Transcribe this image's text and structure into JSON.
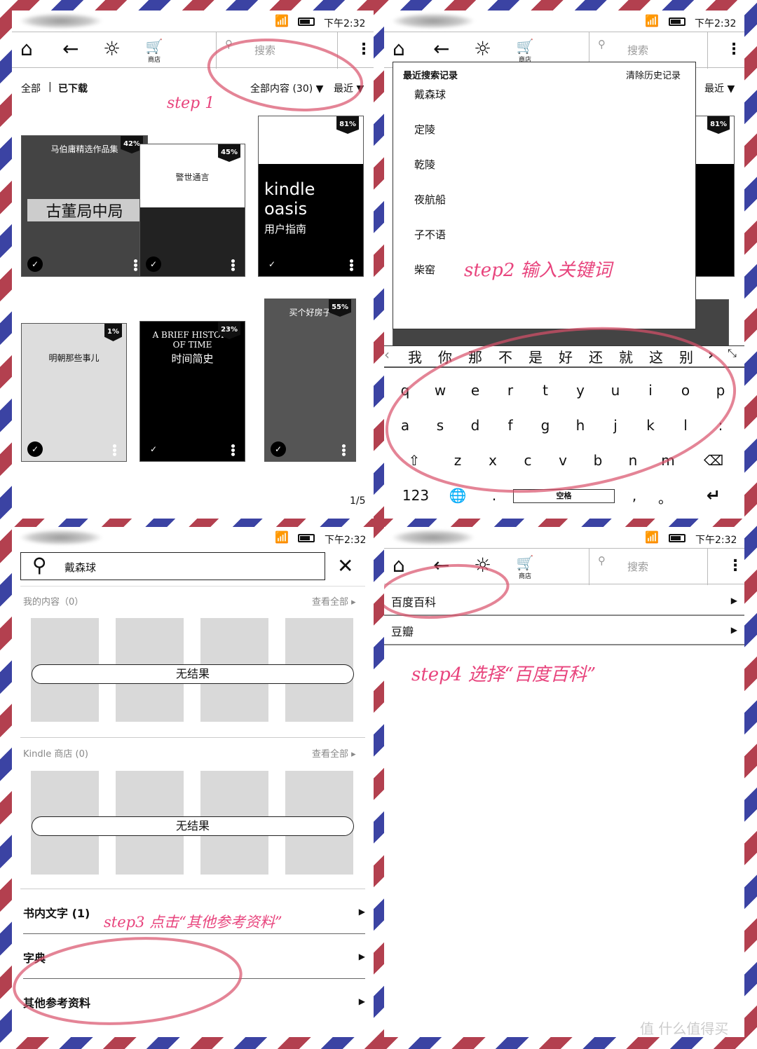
{
  "status": {
    "time": "下午2:32"
  },
  "toolbar": {
    "store_label": "商店",
    "search_placeholder": "搜索"
  },
  "library": {
    "filter_all": "全部",
    "separator": "|",
    "filter_downloaded": "已下载",
    "content_filter": "全部内容 (30) ▼",
    "sort": "最近 ▼",
    "page": "1/5",
    "books": [
      {
        "title": "马伯庸精选作品集",
        "subtitle": "古董局中局",
        "progress": "42%",
        "checked": true
      },
      {
        "title": "警世通言",
        "subtitle": "",
        "progress": "45%",
        "checked": true
      },
      {
        "title": "kindle oasis",
        "subtitle": "用户指南",
        "progress": "81%",
        "checked": true
      },
      {
        "title": "明朝那些事儿",
        "subtitle": "",
        "progress": "1%",
        "checked": true
      },
      {
        "title": "A BRIEF HISTORY OF TIME",
        "subtitle": "时间简史",
        "progress": "23%",
        "checked": true
      },
      {
        "title": "买个好房子",
        "subtitle": "",
        "progress": "55%",
        "checked": true
      }
    ]
  },
  "annotations": {
    "step1": "step 1",
    "step2": "step2 输入关键词",
    "step3": "step3 点击“其他参考资料”",
    "step4": "step4 选择“百度百科”"
  },
  "search_history": {
    "title": "最近搜索记录",
    "clear": "清除历史记录",
    "items": [
      "戴森球",
      "定陵",
      "乾陵",
      "夜航船",
      "子不语",
      "柴窑"
    ]
  },
  "keyboard": {
    "candidates": [
      "我",
      "你",
      "那",
      "不",
      "是",
      "好",
      "还",
      "就",
      "这",
      "别"
    ],
    "rows": [
      [
        "q",
        "w",
        "e",
        "r",
        "t",
        "y",
        "u",
        "i",
        "o",
        "p"
      ],
      [
        "a",
        "s",
        "d",
        "f",
        "g",
        "h",
        "j",
        "k",
        "l",
        ":"
      ],
      [
        "z",
        "x",
        "c",
        "v",
        "b",
        "n",
        "m"
      ]
    ],
    "num_key": "123",
    "space": "空格",
    "period": ".",
    "comma": ",",
    "dot": "。"
  },
  "results": {
    "query": "戴森球",
    "my_content": "我的内容（0）",
    "kindle_store": "Kindle 商店 (0)",
    "view_all": "查看全部 ▸",
    "no_result": "无结果",
    "sections": [
      {
        "label": "书内文字 (1)"
      },
      {
        "label": "字典"
      },
      {
        "label": "其他参考资料"
      }
    ]
  },
  "reference": {
    "items": [
      "百度百科",
      "豆瓣"
    ]
  },
  "watermark": "值 什么值得买",
  "colors": {
    "annotation": "#e8447d",
    "circle": "#d9506a",
    "airmail_red": "#b3404f",
    "airmail_blue": "#3b43a3"
  }
}
